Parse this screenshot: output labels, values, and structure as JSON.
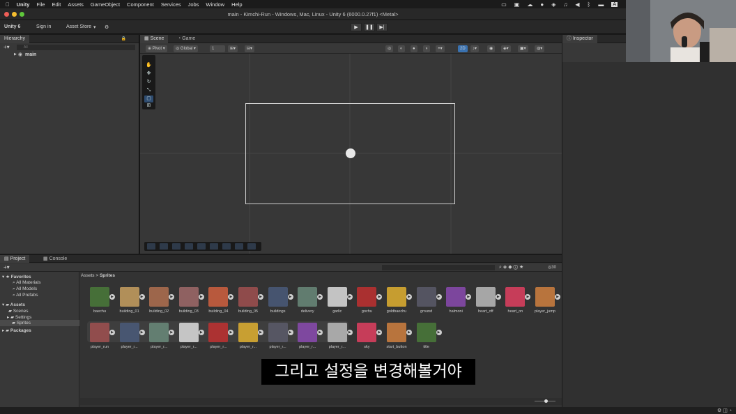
{
  "menubar": {
    "app": "Unity",
    "items": [
      "File",
      "Edit",
      "Assets",
      "GameObject",
      "Component",
      "Services",
      "Jobs",
      "Window",
      "Help"
    ],
    "status_letter": "A"
  },
  "window": {
    "title": "main - Kimchi-Run - Windows, Mac, Linux - Unity 6 (6000.0.27f1) <Metal>"
  },
  "toolbar": {
    "account": "Unity 6",
    "sign_in": "Sign in",
    "asset_store": "Asset Store"
  },
  "hierarchy": {
    "tab": "Hierarchy",
    "search_placeholder": "All",
    "root": "main"
  },
  "scene": {
    "tabs": [
      "Scene",
      "Game"
    ],
    "pivot": "Pivot",
    "global": "Global",
    "grid_snap": "1",
    "view_2d": "2D"
  },
  "inspector": {
    "tab": "Inspector"
  },
  "project": {
    "tabs": [
      "Project",
      "Console"
    ],
    "count": "30",
    "breadcrumb": [
      "Assets",
      "Sprites"
    ],
    "tree": {
      "favorites": "Favorites",
      "fav_items": [
        "All Materials",
        "All Models",
        "All Prefabs"
      ],
      "assets": "Assets",
      "asset_items": [
        "Scenes",
        "Settings",
        "Sprites"
      ],
      "packages": "Packages"
    },
    "row1": [
      "baechu",
      "building_01",
      "building_02",
      "building_03",
      "building_04",
      "building_05",
      "buildings",
      "delivery",
      "garlic",
      "gochu",
      "goldbaechu",
      "ground",
      "halmoni",
      "heart_off",
      "heart_on",
      "player_jump"
    ],
    "row2": [
      "player_run",
      "player_r...",
      "player_r...",
      "player_r...",
      "player_r...",
      "player_r...",
      "player_r...",
      "player_r...",
      "player_r...",
      "sky",
      "start_button",
      "title"
    ]
  },
  "subtitle": "그리고 설정을 변경해볼거야",
  "colors": {
    "accent": "#3a72b0",
    "panel": "#383838",
    "viewport": "#373737"
  }
}
